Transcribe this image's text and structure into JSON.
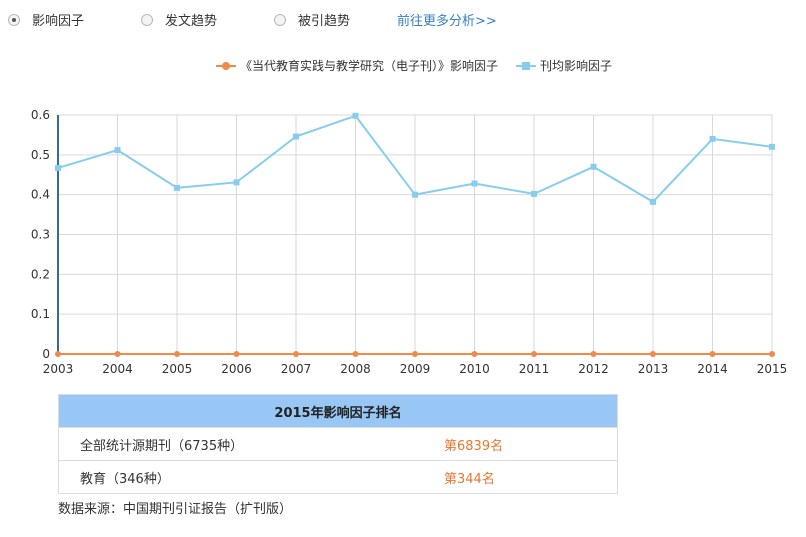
{
  "tabs": [
    {
      "label": "影响因子",
      "checked": true
    },
    {
      "label": "发文趋势",
      "checked": false
    },
    {
      "label": "被引趋势",
      "checked": false
    }
  ],
  "more_link": "前往更多分析>>",
  "legend": {
    "series1": "《当代教育实践与教学研究（电子刊）》影响因子",
    "series2": "刊均影响因子"
  },
  "colors": {
    "series1": "#f08a4b",
    "series2": "#87cdf0",
    "table_header_bg": "#99c7f5",
    "rank_text": "#e8772e",
    "link": "#3a7ec0"
  },
  "chart_data": {
    "type": "line",
    "x": [
      "2003",
      "2004",
      "2005",
      "2006",
      "2007",
      "2008",
      "2009",
      "2010",
      "2011",
      "2012",
      "2013",
      "2014",
      "2015"
    ],
    "y_ticks": [
      "0",
      "0.1",
      "0.2",
      "0.3",
      "0.4",
      "0.5",
      "0.6"
    ],
    "ylim": [
      0,
      0.6
    ],
    "grid": true,
    "legend_position": "top-center",
    "series": [
      {
        "name": "《当代教育实践与教学研究（电子刊）》影响因子",
        "values": [
          0,
          0,
          0,
          0,
          0,
          0,
          0,
          0,
          0,
          0,
          0,
          0,
          0
        ]
      },
      {
        "name": "刊均影响因子",
        "values": [
          0.467,
          0.512,
          0.417,
          0.431,
          0.546,
          0.598,
          0.4,
          0.428,
          0.402,
          0.47,
          0.382,
          0.54,
          0.52
        ]
      }
    ]
  },
  "table": {
    "title": "2015年影响因子排名",
    "rows": [
      {
        "category": "全部统计源期刊（6735种）",
        "rank": "第6839名"
      },
      {
        "category": "教育（346种）",
        "rank": "第344名"
      }
    ]
  },
  "source": "数据来源：中国期刊引证报告（扩刊版）"
}
